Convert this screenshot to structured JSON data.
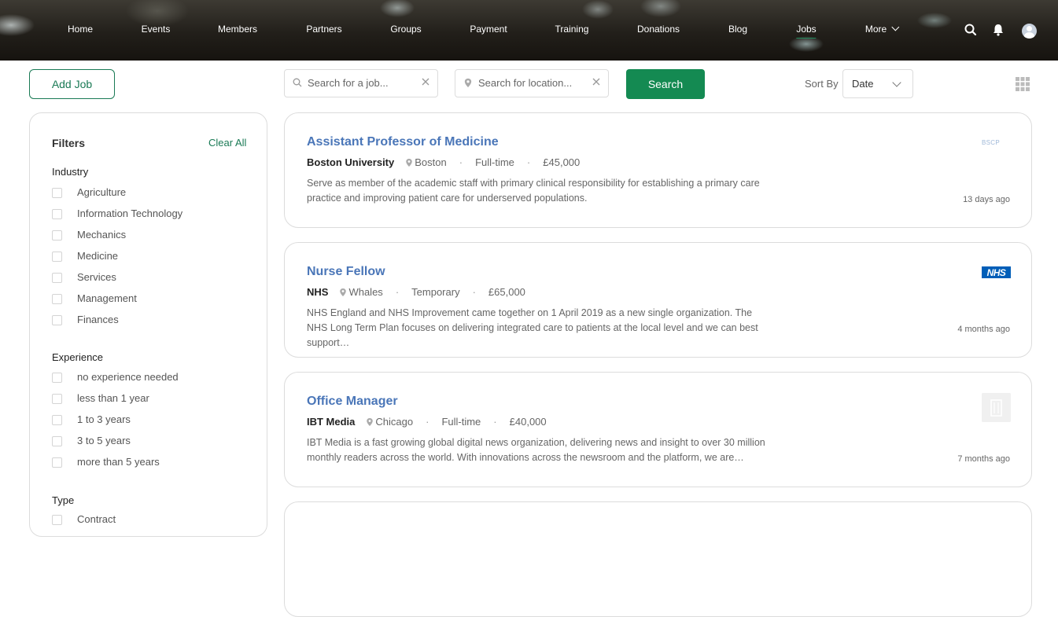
{
  "nav": {
    "items": [
      {
        "label": "Home"
      },
      {
        "label": "Events"
      },
      {
        "label": "Members"
      },
      {
        "label": "Partners"
      },
      {
        "label": "Groups"
      },
      {
        "label": "Payment"
      },
      {
        "label": "Training"
      },
      {
        "label": "Donations"
      },
      {
        "label": "Blog"
      },
      {
        "label": "Jobs",
        "active": true
      },
      {
        "label": "More"
      }
    ],
    "icons": [
      "search-icon",
      "bell-icon",
      "user-avatar-icon"
    ]
  },
  "toolbar": {
    "add_job": "Add Job",
    "job_search_placeholder": "Search for a job...",
    "location_placeholder": "Search for location...",
    "search_button": "Search",
    "sort_label": "Sort By",
    "sort_value": "Date",
    "view_icon": "grid-view-icon"
  },
  "filters": {
    "title": "Filters",
    "clear_all": "Clear All",
    "groups": [
      {
        "title": "Industry",
        "options": [
          "Agriculture",
          "Information Technology",
          "Mechanics",
          "Medicine",
          "Services",
          "Management",
          "Finances"
        ]
      },
      {
        "title": "Experience",
        "options": [
          "no experience needed",
          "less than 1 year",
          "1 to 3 years",
          "3 to 5 years",
          "more than 5 years"
        ]
      },
      {
        "title": "Type",
        "options": [
          "Contract"
        ]
      }
    ]
  },
  "jobs": [
    {
      "title": "Assistant Professor of Medicine",
      "company": "Boston University",
      "location": "Boston",
      "type": "Full-time",
      "salary": "£45,000",
      "description": "Serve as member of the academic staff with primary clinical responsibility for establishing a primary care practice and improving patient care for underserved populations.",
      "posted": "13 days ago",
      "logo_text": "BSCP"
    },
    {
      "title": "Nurse Fellow",
      "company": "NHS",
      "location": "Whales",
      "type": "Temporary",
      "salary": "£65,000",
      "description": "NHS England and NHS Improvement came together on 1 April 2019 as a new single organization. The NHS Long Term Plan focuses on delivering integrated care to patients at the local level and we can best support…",
      "posted": "4 months ago",
      "logo_text": "NHS"
    },
    {
      "title": "Office Manager",
      "company": "IBT Media",
      "location": "Chicago",
      "type": "Full-time",
      "salary": "£40,000",
      "description": "IBT Media is a fast growing global digital news organization, delivering news and insight to over 30 million monthly readers across the world. With innovations across the newsroom and the platform, we are…",
      "posted": "7 months ago",
      "logo_text": ""
    }
  ]
}
